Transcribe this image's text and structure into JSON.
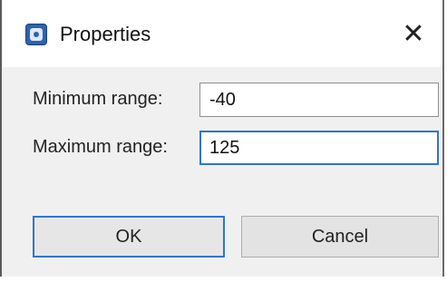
{
  "dialog": {
    "title": "Properties",
    "close_glyph": "✕",
    "icon": "app-icon"
  },
  "fields": {
    "min": {
      "label": "Minimum range:",
      "value": "-40"
    },
    "max": {
      "label": "Maximum range:",
      "value": "125"
    }
  },
  "buttons": {
    "ok": "OK",
    "cancel": "Cancel"
  },
  "colors": {
    "accent": "#2f74cf",
    "dialog_bg": "#f0f0f0",
    "titlebar_bg": "#ffffff"
  }
}
